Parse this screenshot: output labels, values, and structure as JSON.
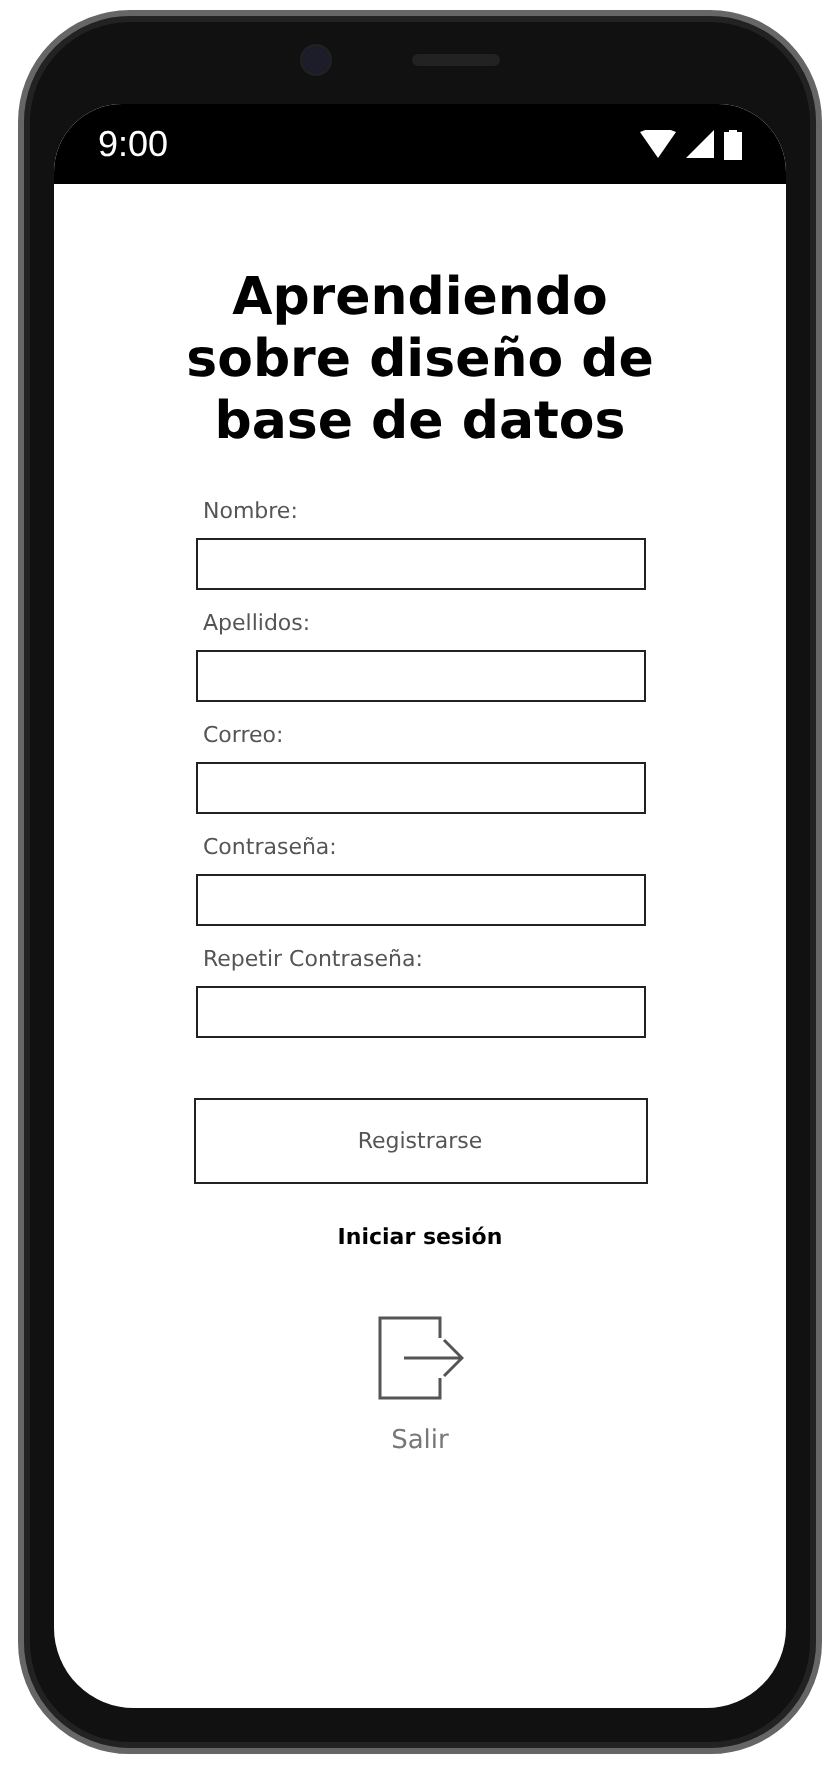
{
  "status_bar": {
    "time": "9:00"
  },
  "title": "Aprendiendo sobre diseño de base de datos",
  "fields": [
    {
      "label": "Nombre:"
    },
    {
      "label": "Apellidos:"
    },
    {
      "label": "Correo:"
    },
    {
      "label": "Contraseña:"
    },
    {
      "label": "Repetir Contraseña:"
    }
  ],
  "register_button": "Registrarse",
  "login_link": "Iniciar sesión",
  "exit": {
    "label": "Salir"
  }
}
